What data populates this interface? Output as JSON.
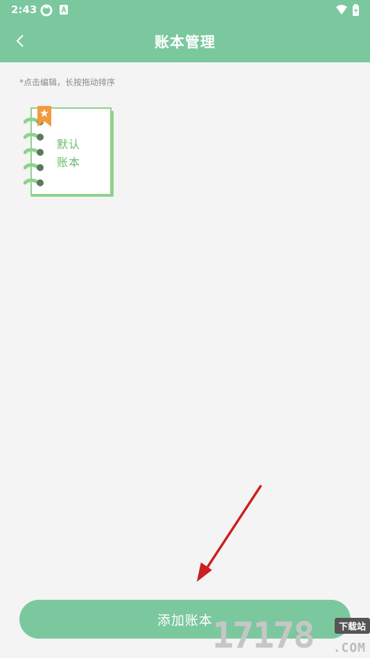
{
  "status_bar": {
    "time": "2:43"
  },
  "header": {
    "title": "账本管理"
  },
  "hint": "*点击编辑，长按拖动排序",
  "books": [
    {
      "line1": "默认",
      "line2": "账本"
    }
  ],
  "add_button": "添加账本",
  "watermark": {
    "number": "17178",
    "badge": "下载站",
    "suffix": ".COM"
  },
  "colors": {
    "primary": "#7bc89e",
    "book_green": "#8fd18c",
    "bookmark": "#f39a3c",
    "arrow": "#cc1f1f"
  }
}
